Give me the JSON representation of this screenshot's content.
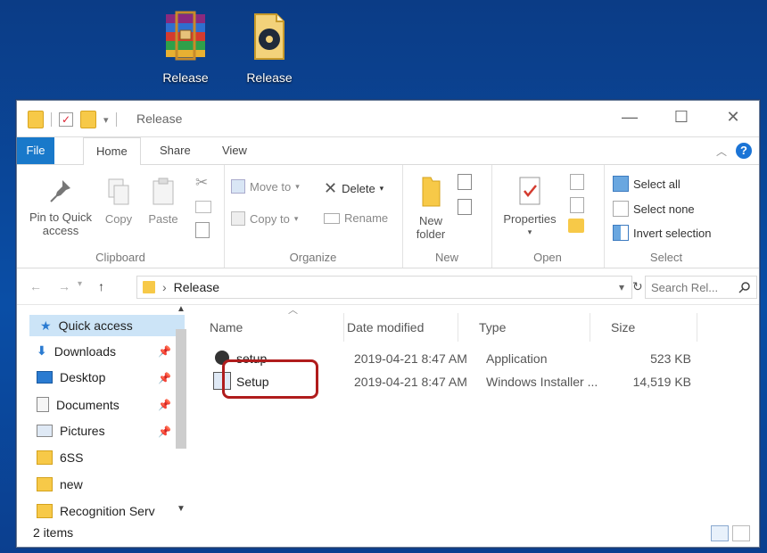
{
  "desktop": {
    "icons": [
      {
        "label": "Release",
        "kind": "winrar-archive-icon"
      },
      {
        "label": "Release",
        "kind": "disc-image-file-icon"
      }
    ]
  },
  "window": {
    "title": "Release",
    "tabs": {
      "file": "File",
      "home": "Home",
      "share": "Share",
      "view": "View"
    },
    "controls": {
      "minimize": "—",
      "maximize": "☐",
      "close": "✕"
    }
  },
  "ribbon": {
    "clipboard": {
      "pin_label": "Pin to Quick access",
      "copy": "Copy",
      "paste": "Paste",
      "group": "Clipboard"
    },
    "organize": {
      "move_to": "Move to",
      "copy_to": "Copy to",
      "delete": "Delete",
      "rename": "Rename",
      "group": "Organize"
    },
    "new": {
      "new_folder": "New folder",
      "group": "New"
    },
    "open": {
      "properties": "Properties",
      "group": "Open"
    },
    "select": {
      "select_all": "Select all",
      "select_none": "Select none",
      "invert": "Invert selection",
      "group": "Select"
    }
  },
  "address": {
    "path": "Release",
    "search_placeholder": "Search Rel..."
  },
  "nav": {
    "items": [
      {
        "label": "Quick access"
      },
      {
        "label": "Downloads"
      },
      {
        "label": "Desktop"
      },
      {
        "label": "Documents"
      },
      {
        "label": "Pictures"
      },
      {
        "label": "6SS"
      },
      {
        "label": "new"
      },
      {
        "label": "Recognition Serv"
      }
    ]
  },
  "columns": {
    "name": "Name",
    "date": "Date modified",
    "type": "Type",
    "size": "Size"
  },
  "files": [
    {
      "name": "setup",
      "date": "2019-04-21 8:47 AM",
      "type": "Application",
      "size": "523 KB"
    },
    {
      "name": "Setup",
      "date": "2019-04-21 8:47 AM",
      "type": "Windows Installer ...",
      "size": "14,519 KB"
    }
  ],
  "status": {
    "count": "2 items"
  },
  "colors": {
    "accent": "#1979ca",
    "highlight_box": "#b01c1c",
    "selected_nav": "#cce4f7"
  }
}
